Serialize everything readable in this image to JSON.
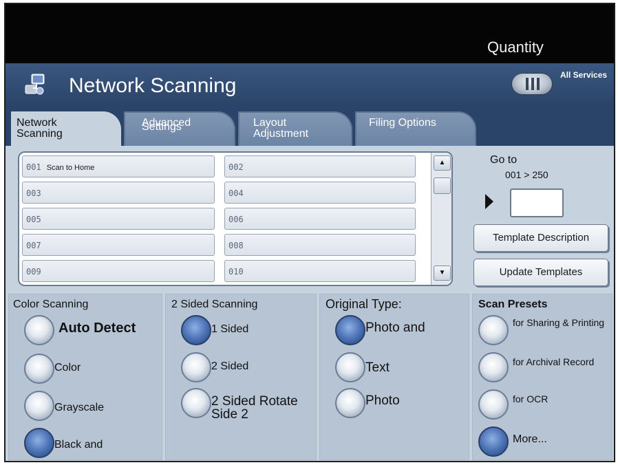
{
  "header": {
    "quantity_label": "Quantity"
  },
  "title_bar": {
    "title": "Network Scanning",
    "all_services_label": "All Services"
  },
  "tabs": [
    {
      "line1": "Network",
      "line2": "Scanning",
      "active": true
    },
    {
      "line1": "Advanced",
      "line2": "Settings",
      "active": false
    },
    {
      "line1": "Layout",
      "line2": "Adjustment",
      "active": false
    },
    {
      "line1": "Filing Options",
      "line2": "",
      "active": false
    }
  ],
  "templates": [
    {
      "num": "001",
      "name": "Scan to Home"
    },
    {
      "num": "002",
      "name": ""
    },
    {
      "num": "003",
      "name": ""
    },
    {
      "num": "004",
      "name": ""
    },
    {
      "num": "005",
      "name": ""
    },
    {
      "num": "006",
      "name": ""
    },
    {
      "num": "007",
      "name": ""
    },
    {
      "num": "008",
      "name": ""
    },
    {
      "num": "009",
      "name": ""
    },
    {
      "num": "010",
      "name": ""
    }
  ],
  "scrollbar": {
    "up_glyph": "▲",
    "down_glyph": "▼"
  },
  "goto": {
    "label": "Go to",
    "range": "001 > 250",
    "value": ""
  },
  "side_buttons": {
    "template_description": "Template Description",
    "update_templates": "Update Templates"
  },
  "color_scanning": {
    "title": "Color Scanning",
    "options": [
      "Auto Detect",
      "Color",
      "Grayscale",
      "Black and"
    ],
    "selected": "Black and"
  },
  "two_sided": {
    "title": "2 Sided Scanning",
    "options": [
      "1 Sided",
      "2 Sided",
      "2 Sided Rotate Side 2"
    ],
    "selected": "1 Sided"
  },
  "original_type": {
    "title": "Original Type:",
    "options": [
      "Photo and",
      "Text",
      "Photo"
    ],
    "selected": "Photo and"
  },
  "scan_presets": {
    "title": "Scan Presets",
    "options": [
      "for Sharing & Printing",
      "for Archival Record",
      "for OCR",
      "More..."
    ],
    "selected": "More..."
  },
  "colors": {
    "title_bar": "#2a4368",
    "panel": "#c7d2df",
    "selected_radio": "#4e74b6"
  }
}
